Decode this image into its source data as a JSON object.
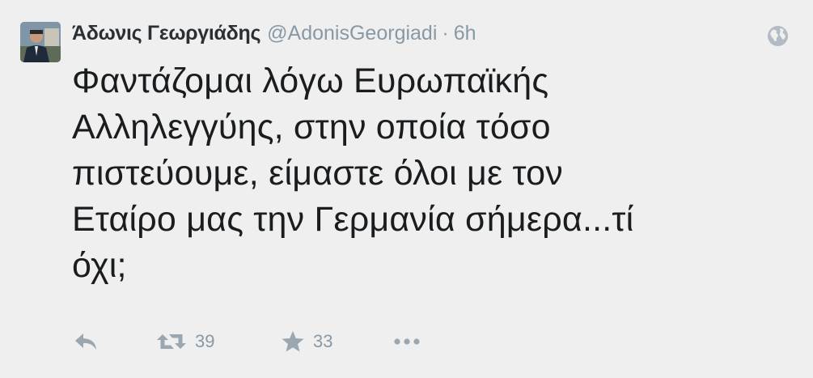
{
  "tweet": {
    "author_name": "Άδωνις Γεωργιάδης",
    "username": "@AdonisGeorgiadi",
    "separator": "·",
    "time": "6h",
    "text_lines": [
      "Φαντάζομαι λόγω Ευρωπαϊκής",
      "Αλληλεγγύης, στην οποία τόσο",
      "πιστεύουμε, είμαστε όλοι με τον",
      "Εταίρο μας την Γερμανία σήμερα...τί",
      "όχι;"
    ],
    "retweet_count": "39",
    "favorite_count": "33"
  },
  "icons": {
    "avatar": "profile-photo",
    "globe": "globe-icon",
    "reply": "reply-icon",
    "retweet": "retweet-icon",
    "favorite": "star-icon",
    "more": "more-dots-icon"
  },
  "colors": {
    "background": "#efefef",
    "muted": "#8899a6",
    "text": "#1a1d1f"
  }
}
